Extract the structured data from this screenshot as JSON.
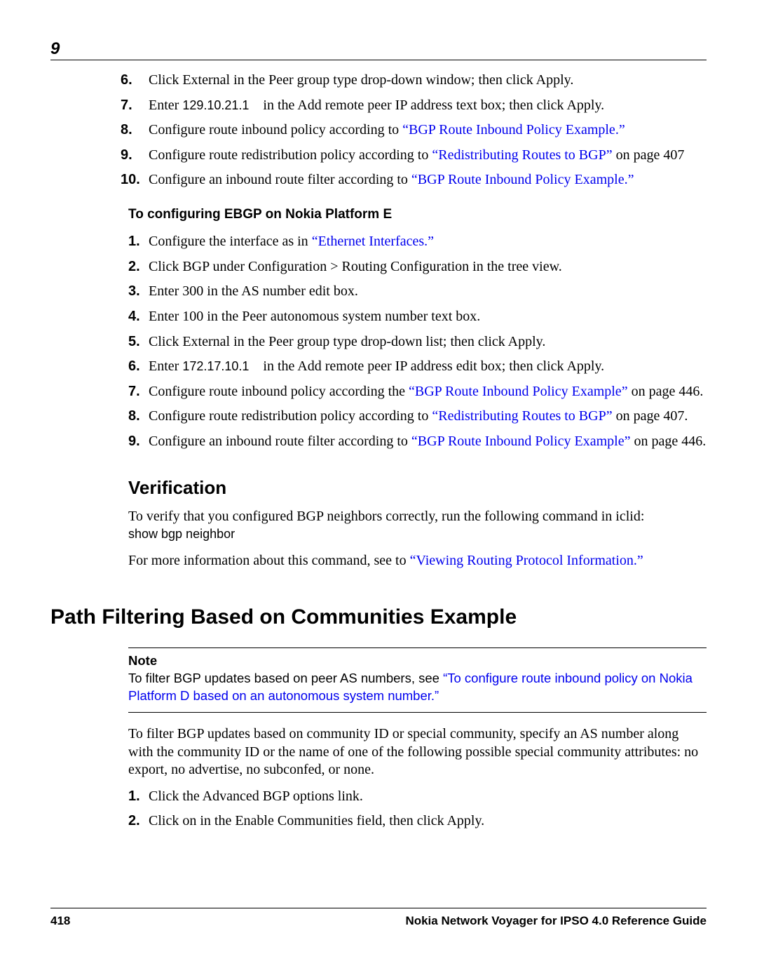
{
  "chapter": "9",
  "listA": {
    "items": [
      {
        "n": "6.",
        "text_a": "Click External in the Peer group type drop-down window; then click Apply."
      },
      {
        "n": "7.",
        "text_a": "Enter ",
        "ip": "129.10.21.1",
        "text_b": " in the Add remote peer IP address text box; then click Apply."
      },
      {
        "n": "8.",
        "text_a": "Configure route inbound policy according to ",
        "link": "“BGP Route Inbound Policy Example.”"
      },
      {
        "n": "9.",
        "text_a": "Configure route redistribution policy according to ",
        "link": "“Redistributing Routes to BGP”",
        "text_b": " on page 407"
      },
      {
        "n": "10.",
        "text_a": "Configure an inbound route filter according to ",
        "link": "“BGP Route Inbound Policy Example.”"
      }
    ]
  },
  "subhead": "To configuring EBGP on Nokia Platform E",
  "listB": {
    "items": [
      {
        "n": "1.",
        "text_a": "Configure the interface as in ",
        "link": "“Ethernet Interfaces.”"
      },
      {
        "n": "2.",
        "text_a": "Click BGP under Configuration > Routing Configuration in the tree view."
      },
      {
        "n": "3.",
        "text_a": "Enter 300 in the AS number edit box."
      },
      {
        "n": "4.",
        "text_a": "Enter 100 in the Peer autonomous system number text box."
      },
      {
        "n": "5.",
        "text_a": "Click External in the Peer group type drop-down list; then click Apply."
      },
      {
        "n": "6.",
        "text_a": "Enter ",
        "ip": "172.17.10.1",
        "text_b": " in the Add remote peer IP address edit box; then click Apply."
      },
      {
        "n": "7.",
        "text_a": "Configure route inbound policy according the ",
        "link": "“BGP Route Inbound Policy Example”",
        "text_b": " on page 446."
      },
      {
        "n": "8.",
        "text_a": "Configure route redistribution policy according to ",
        "link": "“Redistributing Routes to BGP”",
        "text_b": " on page 407."
      },
      {
        "n": "9.",
        "text_a": "Configure an inbound route filter according to ",
        "link": "“BGP Route Inbound Policy Example”",
        "text_b": " on page 446."
      }
    ]
  },
  "verif": {
    "heading": "Verification",
    "p1": "To verify that you configured BGP neighbors correctly, run the following command in iclid:",
    "cmd": "show bgp neighbor",
    "p2a": "For more information about this command, see to ",
    "p2link": "“Viewing Routing Protocol Information.”"
  },
  "h1": "Path Filtering Based on Communities Example",
  "note": {
    "label": "Note",
    "text_a": "To filter BGP updates based on peer AS numbers, see ",
    "link": "“To configure route inbound policy on Nokia Platform D based on an autonomous system number.”"
  },
  "filter": {
    "p": "To filter BGP updates based on community ID or special community, specify an AS number along with the community ID or the name of one of the following possible special community attributes: no export, no advertise, no subconfed, or none.",
    "items": [
      {
        "n": "1.",
        "text_a": "Click the Advanced BGP options link."
      },
      {
        "n": "2.",
        "text_a": "Click on in the Enable Communities field, then click Apply."
      }
    ]
  },
  "footer": {
    "page": "418",
    "title": "Nokia Network Voyager for IPSO 4.0 Reference Guide"
  }
}
